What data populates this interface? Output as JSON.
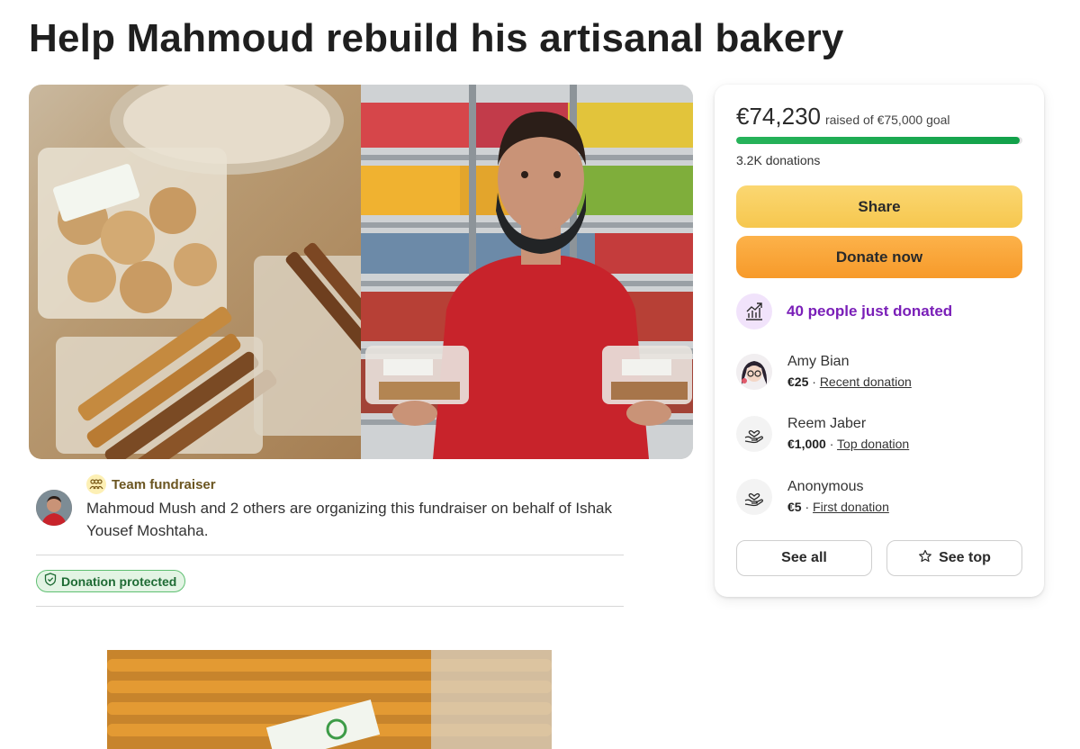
{
  "page": {
    "title": "Help Mahmoud rebuild his artisanal bakery"
  },
  "organizer": {
    "team_label": "Team fundraiser",
    "text": "Mahmoud Mush and 2 others are organizing this fundraiser on behalf of Ishak Yousef Moshtaha."
  },
  "badge": {
    "protected_label": "Donation protected"
  },
  "card": {
    "raised_amount": "€74,230",
    "raised_goal_text": "raised of €75,000 goal",
    "progress_fraction": 0.99,
    "donation_count": "3.2K donations",
    "share_label": "Share",
    "donate_label": "Donate now",
    "trend_text": "40 people just donated",
    "donors": [
      {
        "name": "Amy Bian",
        "amount": "€25",
        "type": "Recent donation"
      },
      {
        "name": "Reem Jaber",
        "amount": "€1,000",
        "type": "Top donation"
      },
      {
        "name": "Anonymous",
        "amount": "€5",
        "type": "First donation"
      }
    ],
    "see_all_label": "See all",
    "see_top_label": "See top"
  },
  "colors": {
    "accent_green": "#12a14a",
    "share_yellow": "#f6c74e",
    "donate_orange": "#f79a2a",
    "trend_purple": "#7a1fb8"
  },
  "icons": {
    "team": "people-group-icon",
    "protected": "shield-check-icon",
    "trend": "trending-up-icon",
    "anonymous_donor": "heart-hand-icon",
    "see_top": "star-icon"
  }
}
